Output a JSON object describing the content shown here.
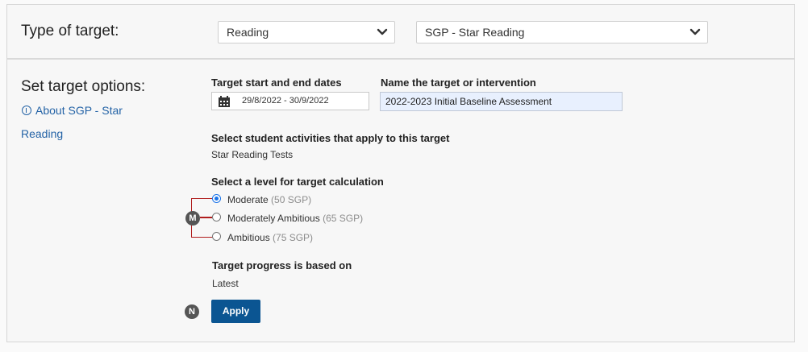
{
  "header": {
    "type_label": "Type of target:",
    "subject_select": "Reading",
    "target_type_select": "SGP - Star Reading"
  },
  "options": {
    "section_label": "Set target options:",
    "about_link_line1": "About SGP - Star",
    "about_link_line2": "Reading",
    "dates_label": "Target start and end dates",
    "date_range": "29/8/2022 - 30/9/2022",
    "name_label": "Name the target or intervention",
    "name_value": "2022-2023 Initial Baseline Assessment",
    "activities_label": "Select student activities that apply to this target",
    "activities_value": "Star Reading Tests",
    "level_label": "Select a level for target calculation",
    "levels": [
      {
        "name": "Moderate",
        "detail": "(50 SGP)",
        "selected": true
      },
      {
        "name": "Moderately Ambitious",
        "detail": "(65 SGP)",
        "selected": false
      },
      {
        "name": "Ambitious",
        "detail": "(75 SGP)",
        "selected": false
      }
    ],
    "progress_label": "Target progress is based on",
    "progress_value": "Latest",
    "apply_label": "Apply"
  },
  "markers": {
    "m": "M",
    "n": "N"
  },
  "colors": {
    "apply": "#0b5592",
    "link": "#2463a6",
    "bracket": "#b01c1c"
  }
}
